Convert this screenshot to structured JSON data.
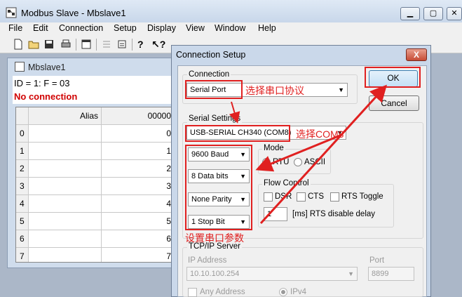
{
  "window": {
    "title": "Modbus Slave - Mbslave1",
    "min_label": "▭",
    "restore_label": "▢",
    "close_label": "✕"
  },
  "menu": [
    "File",
    "Edit",
    "Connection",
    "Setup",
    "Display",
    "View",
    "Window",
    "Help"
  ],
  "child": {
    "title": "Mbslave1",
    "id_line": "ID = 1: F = 03",
    "status": "No connection",
    "grid": {
      "headers": [
        "Alias",
        "00000"
      ],
      "rows": [
        {
          "index": "0",
          "value": "0"
        },
        {
          "index": "1",
          "value": "1"
        },
        {
          "index": "2",
          "value": "2"
        },
        {
          "index": "3",
          "value": "3"
        },
        {
          "index": "4",
          "value": "4"
        },
        {
          "index": "5",
          "value": "5"
        },
        {
          "index": "6",
          "value": "6"
        },
        {
          "index": "7",
          "value": "7"
        }
      ]
    }
  },
  "dialog": {
    "title": "Connection Setup",
    "close": "X",
    "connection_label": "Connection",
    "connection_value": "Serial Port",
    "ok": "OK",
    "cancel": "Cancel",
    "serial_settings_label": "Serial Settings",
    "port_value": "USB-SERIAL CH340 (COM8)",
    "baud": "9600 Baud",
    "data_bits": "8 Data bits",
    "parity": "None Parity",
    "stop_bits": "1 Stop Bit",
    "mode_label": "Mode",
    "mode_rtu": "RTU",
    "mode_ascii": "ASCII",
    "flow_label": "Flow Control",
    "dsr": "DSR",
    "cts": "CTS",
    "rts_toggle": "RTS Toggle",
    "rts_delay_value": "1",
    "rts_delay_label": "[ms] RTS disable delay",
    "tcp_label": "TCP/IP Server",
    "ip_label": "IP Address",
    "ip_value": "10.10.100.254",
    "port_label": "Port",
    "port_number": "8899",
    "any_address": "Any Address",
    "ipv4": "IPv4"
  },
  "annotations": {
    "connection": "选择串口协议",
    "port": "选择COM8",
    "serial": "设置串口参数"
  },
  "colors": {
    "annotation": "#e02020",
    "status_error": "#d00000"
  }
}
